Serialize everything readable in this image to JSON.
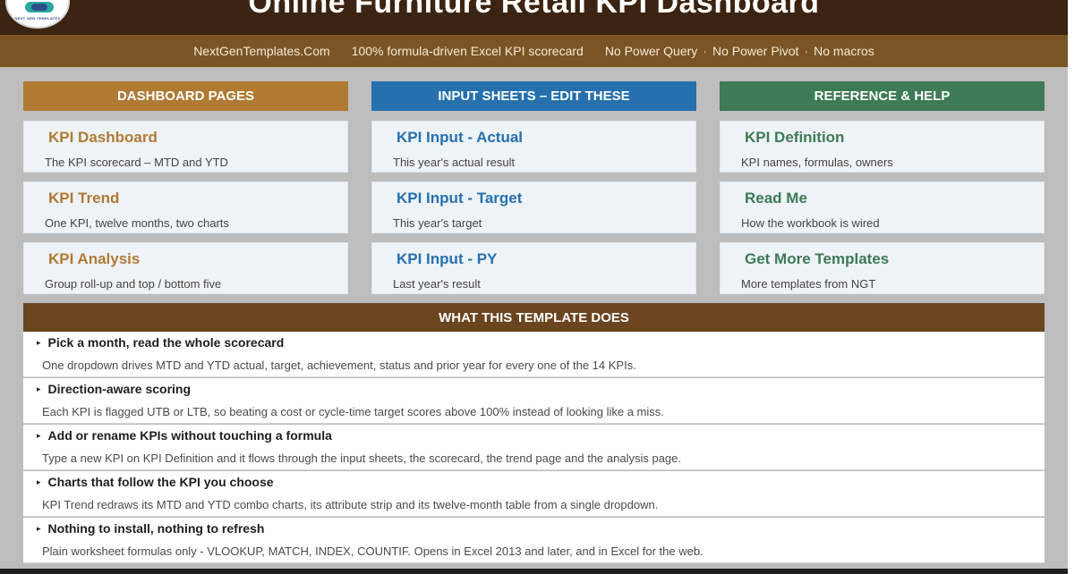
{
  "header": {
    "title": "Online Furniture Retail KPI Dashboard",
    "logo_text": "NEXT GEN TEMPLATES"
  },
  "subheader": {
    "site": "NextGenTemplates.Com",
    "tagline": "100% formula-driven Excel KPI scorecard",
    "features": [
      "No Power Query",
      "No Power Pivot",
      "No macros"
    ],
    "separator": "·"
  },
  "columns": [
    {
      "header": "DASHBOARD PAGES",
      "color": "#b07a33",
      "cards": [
        {
          "title": "KPI Dashboard",
          "desc": "The KPI scorecard – MTD and YTD"
        },
        {
          "title": "KPI Trend",
          "desc": "One KPI, twelve months, two charts"
        },
        {
          "title": "KPI Analysis",
          "desc": "Group roll-up and top / bottom five"
        }
      ]
    },
    {
      "header": "INPUT SHEETS – EDIT THESE",
      "color": "#2570ad",
      "cards": [
        {
          "title": "KPI Input - Actual",
          "desc": "This year's actual result"
        },
        {
          "title": "KPI Input - Target",
          "desc": "This year's target"
        },
        {
          "title": "KPI Input - PY",
          "desc": "Last year's result"
        }
      ]
    },
    {
      "header": "REFERENCE & HELP",
      "color": "#3d7a55",
      "cards": [
        {
          "title": "KPI Definition",
          "desc": "KPI names, formulas, owners"
        },
        {
          "title": "Read Me",
          "desc": "How the workbook is wired"
        },
        {
          "title": "Get More Templates",
          "desc": "More templates from NGT"
        }
      ]
    }
  ],
  "what": {
    "header": "WHAT THIS TEMPLATE DOES",
    "bullet": "▸",
    "items": [
      {
        "title": "Pick a month, read the whole scorecard",
        "desc": "One dropdown drives MTD and YTD actual, target, achievement, status and prior year for every one of the 14 KPIs."
      },
      {
        "title": "Direction-aware scoring",
        "desc": "Each KPI is flagged UTB or LTB, so beating a cost or cycle-time target scores above 100% instead of looking like a miss."
      },
      {
        "title": "Add or rename KPIs without touching a formula",
        "desc": "Type a new KPI on KPI Definition and it flows through the input sheets, the scorecard, the trend page and the analysis page."
      },
      {
        "title": "Charts that follow the KPI you choose",
        "desc": "KPI Trend redraws its MTD and YTD combo charts, its attribute strip and its twelve-month table from a single dropdown."
      },
      {
        "title": "Nothing to install, nothing to refresh",
        "desc": "Plain worksheet formulas only - VLOOKUP, MATCH, INDEX, COUNTIF. Opens in Excel 2013 and later, and in Excel for the web."
      }
    ]
  }
}
